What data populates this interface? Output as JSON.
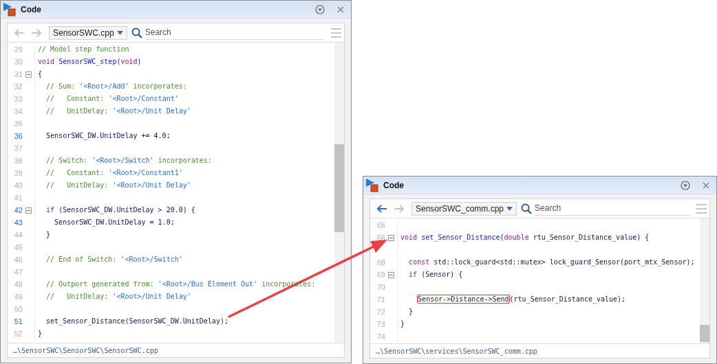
{
  "windows": [
    {
      "title": "Code",
      "nav": [
        {
          "kind": "back",
          "disabled": true
        },
        {
          "kind": "forward",
          "disabled": true
        }
      ],
      "file": "SensorSWC.cpp",
      "search": {
        "placeholder": "Search"
      },
      "lines": [
        {
          "number": "29",
          "marked": false,
          "fold": false,
          "tokens": [
            {
              "kind": "comment",
              "text": "// Model step function"
            }
          ]
        },
        {
          "number": "30",
          "marked": false,
          "fold": false,
          "tokens": [
            {
              "kind": "keyword",
              "text": "void"
            },
            {
              "kind": "function",
              "text": " SensorSWC_step"
            },
            {
              "kind": "plain",
              "text": "("
            },
            {
              "kind": "keyword",
              "text": "void"
            },
            {
              "kind": "plain",
              "text": ")"
            }
          ]
        },
        {
          "number": "31",
          "marked": false,
          "fold": true,
          "tokens": [
            {
              "kind": "plain",
              "text": "{"
            }
          ]
        },
        {
          "number": "32",
          "marked": false,
          "fold": false,
          "tokens": [
            {
              "kind": "comment",
              "text": "  // Sum: "
            },
            {
              "kind": "string",
              "text": "'<Root>/Add'"
            },
            {
              "kind": "comment",
              "text": " incorporates:"
            }
          ]
        },
        {
          "number": "33",
          "marked": false,
          "fold": false,
          "tokens": [
            {
              "kind": "comment",
              "text": "  //   Constant: "
            },
            {
              "kind": "string",
              "text": "'<Root>/Constant'"
            }
          ]
        },
        {
          "number": "34",
          "marked": false,
          "fold": false,
          "tokens": [
            {
              "kind": "comment",
              "text": "  //   UnitDelay: "
            },
            {
              "kind": "string",
              "text": "'<Root>/Unit Delay'"
            }
          ]
        },
        {
          "number": "35",
          "marked": false,
          "fold": false
        },
        {
          "number": "36",
          "marked": true,
          "fold": false,
          "tokens": [
            {
              "kind": "plain",
              "text": "  SensorSWC_DW.UnitDelay += 4.0;"
            }
          ]
        },
        {
          "number": "37",
          "marked": false,
          "fold": false
        },
        {
          "number": "38",
          "marked": false,
          "fold": false,
          "tokens": [
            {
              "kind": "comment",
              "text": "  // Switch: "
            },
            {
              "kind": "string",
              "text": "'<Root>/Switch'"
            },
            {
              "kind": "comment",
              "text": " incorporates:"
            }
          ]
        },
        {
          "number": "39",
          "marked": false,
          "fold": false,
          "tokens": [
            {
              "kind": "comment",
              "text": "  //   Constant: "
            },
            {
              "kind": "string",
              "text": "'<Root>/Constant1'"
            }
          ]
        },
        {
          "number": "40",
          "marked": false,
          "fold": false,
          "tokens": [
            {
              "kind": "comment",
              "text": "  //   UnitDelay: "
            },
            {
              "kind": "string",
              "text": "'<Root>/Unit Delay'"
            }
          ]
        },
        {
          "number": "41",
          "marked": false,
          "fold": false
        },
        {
          "number": "42",
          "marked": true,
          "fold": true,
          "tokens": [
            {
              "kind": "keyword",
              "text": "  if"
            },
            {
              "kind": "plain",
              "text": " (SensorSWC_DW.UnitDelay > 20.0) {"
            }
          ]
        },
        {
          "number": "43",
          "marked": true,
          "fold": false,
          "tokens": [
            {
              "kind": "plain",
              "text": "    SensorSWC_DW.UnitDelay = 1.0;"
            }
          ]
        },
        {
          "number": "44",
          "marked": false,
          "fold": false,
          "tokens": [
            {
              "kind": "plain",
              "text": "  }"
            }
          ]
        },
        {
          "number": "45",
          "marked": false,
          "fold": false
        },
        {
          "number": "46",
          "marked": false,
          "fold": false,
          "tokens": [
            {
              "kind": "comment",
              "text": "  // End of Switch: "
            },
            {
              "kind": "string",
              "text": "'<Root>/Switch'"
            }
          ]
        },
        {
          "number": "47",
          "marked": false,
          "fold": false
        },
        {
          "number": "48",
          "marked": false,
          "fold": false,
          "tokens": [
            {
              "kind": "comment",
              "text": "  // Outport generated from: "
            },
            {
              "kind": "string",
              "text": "'<Root>/Bus Element Out'"
            },
            {
              "kind": "comment",
              "text": " incorporates:"
            }
          ]
        },
        {
          "number": "49",
          "marked": false,
          "fold": false,
          "tokens": [
            {
              "kind": "comment",
              "text": "  //   UnitDelay: "
            },
            {
              "kind": "string",
              "text": "'<Root>/Unit Delay'"
            }
          ]
        },
        {
          "number": "50",
          "marked": false,
          "fold": false
        },
        {
          "number": "51",
          "marked": true,
          "fold": false,
          "tokens": [
            {
              "kind": "plain",
              "text": "  set_Sensor_Distance(SensorSWC_DW.UnitDelay);"
            }
          ]
        },
        {
          "number": "52",
          "marked": false,
          "fold": false,
          "tokens": [
            {
              "kind": "plain",
              "text": "}"
            }
          ]
        }
      ],
      "status_path": "…\\SensorSWC\\SensorSWC\\SensorSWC.cpp"
    },
    {
      "title": "Code",
      "nav": [
        {
          "kind": "back",
          "disabled": false
        },
        {
          "kind": "forward",
          "disabled": true
        }
      ],
      "file": "SensorSWC_comm.cpp",
      "search": {
        "placeholder": "Search"
      },
      "lines": [
        {
          "number": "65",
          "marked": false,
          "fold": false
        },
        {
          "number": "66",
          "marked": false,
          "fold": true,
          "tokens": [
            {
              "kind": "keyword",
              "text": "void"
            },
            {
              "kind": "function",
              "text": " set_Sensor_Distance"
            },
            {
              "kind": "plain",
              "text": "("
            },
            {
              "kind": "keyword",
              "text": "double"
            },
            {
              "kind": "plain",
              "text": " rtu_Sensor_Distance_value) {"
            }
          ]
        },
        {
          "fold": false
        },
        {
          "number": "68",
          "marked": false,
          "fold": false,
          "tokens": [
            {
              "kind": "keyword",
              "text": "  const"
            },
            {
              "kind": "plain",
              "text": " std::lock_guard<std::mutex> lock_guard_Sensor(port_mtx_Sensor);"
            }
          ]
        },
        {
          "number": "69",
          "marked": false,
          "fold": true,
          "tokens": [
            {
              "kind": "keyword",
              "text": "  if"
            },
            {
              "kind": "plain",
              "text": " (Sensor) {"
            }
          ]
        },
        {
          "number": "70",
          "marked": false,
          "fold": false
        },
        {
          "number": "71",
          "marked": false,
          "fold": false,
          "tokens": [
            {
              "kind": "boxed",
              "text": "    Sensor->Distance->Send"
            },
            {
              "kind": "plain",
              "text": "(rtu_Sensor_Distance_value);"
            }
          ]
        },
        {
          "number": "72",
          "marked": false,
          "fold": false,
          "tokens": [
            {
              "kind": "plain",
              "text": "  }"
            }
          ]
        },
        {
          "number": "73",
          "marked": false,
          "fold": false,
          "tokens": [
            {
              "kind": "plain",
              "text": "}"
            }
          ]
        },
        {
          "number": "74",
          "marked": false,
          "fold": false
        }
      ],
      "status_path": "…\\SensorSWC\\services\\SensorSWC_comm.cpp"
    }
  ]
}
